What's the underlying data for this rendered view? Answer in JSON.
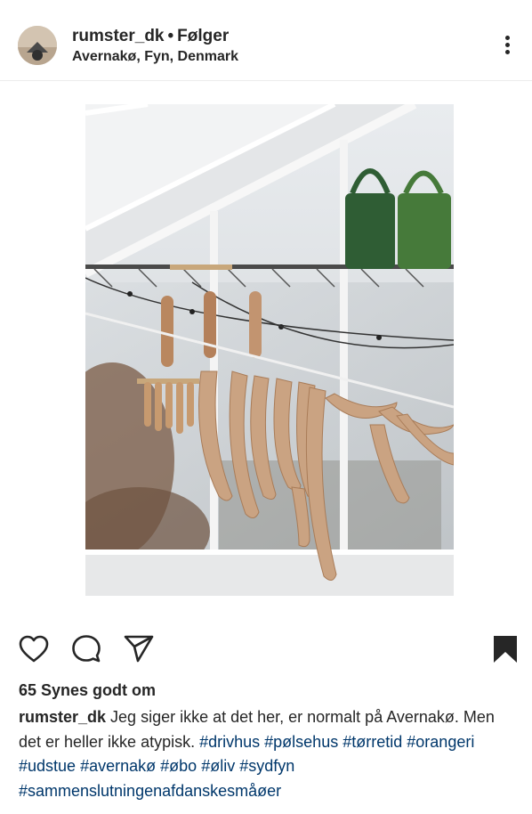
{
  "post": {
    "username": "rumster_dk",
    "separator": "•",
    "follow_status": "Følger",
    "location": "Avernakø, Fyn, Denmark"
  },
  "icons": {
    "more": "more-vertical-icon",
    "like": "heart-icon",
    "comment": "comment-bubble-icon",
    "share": "paper-plane-icon",
    "save": "bookmark-icon"
  },
  "engagement": {
    "likes_text": "65 Synes godt om"
  },
  "caption": {
    "username": "rumster_dk",
    "text": " Jeg siger ikke at det her, er normalt på Avernakø. Men det er heller ikke atypisk. ",
    "hashtags": [
      "#drivhus",
      "#pølsehus",
      "#tørretid",
      "#orangeri",
      "#udstue",
      "#avernakø",
      "#øbo",
      "#øliv",
      "#sydfyn",
      "#sammenslutningenafdanskesmåøer"
    ]
  },
  "colors": {
    "text": "#262626",
    "hashtag": "#00376b",
    "divider": "#ececec"
  }
}
